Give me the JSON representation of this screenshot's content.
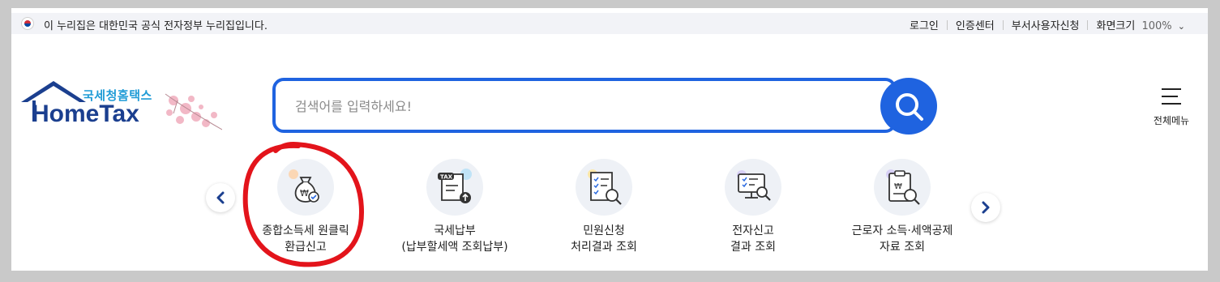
{
  "topbar": {
    "notice": "이 누리집은 대한민국 공식 전자정부 누리집입니다.",
    "links": [
      "로그인",
      "인증센터",
      "부서사용자신청",
      "화면크기"
    ],
    "zoom": "100%"
  },
  "logo": {
    "sub": "국세청홈택스",
    "main": "HomeTax"
  },
  "search": {
    "placeholder": "검색어를 입력하세요!"
  },
  "all_menu": {
    "label": "전체메뉴"
  },
  "quick_menu": [
    {
      "line1": "종합소득세 원클릭",
      "line2": "환급신고",
      "icon": "money-bag-check-icon"
    },
    {
      "line1": "국세납부",
      "line2": "(납부할세액 조회납부)",
      "icon": "tax-document-upload-icon"
    },
    {
      "line1": "민원신청",
      "line2": "처리결과 조회",
      "icon": "checklist-search-icon"
    },
    {
      "line1": "전자신고",
      "line2": "결과 조회",
      "icon": "monitor-search-icon"
    },
    {
      "line1": "근로자 소득·세액공제",
      "line2": "자료 조회",
      "icon": "clipboard-search-icon"
    }
  ],
  "colors": {
    "brand_blue": "#1f63e0",
    "logo_navy": "#1b3f8f",
    "logo_cyan": "#1f9bd6",
    "annotation_red": "#e3141b"
  }
}
